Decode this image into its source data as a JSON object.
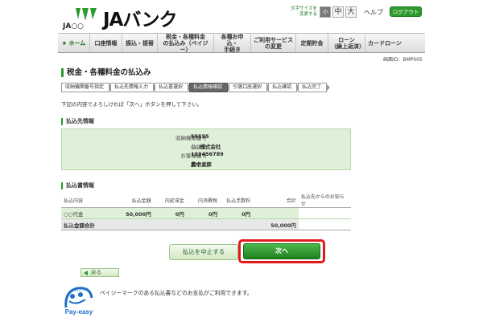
{
  "header": {
    "brand": "JAバンク",
    "ja_sub": "JA○○",
    "fontsize_label": "文字サイズを\n変更する",
    "fontsize_buttons": [
      "小",
      "中",
      "大"
    ],
    "help": "ヘルプ",
    "logout": "ログアウト"
  },
  "nav": {
    "items": [
      "★ ホーム",
      "口座情報",
      "振込・振替",
      "税金・各種料金\nの払込み（ペイジー）",
      "各種お申込・\n手続き",
      "ご利用サービス\nの変更",
      "定期貯金",
      "ローン\n（繰上返済）",
      "カードローン"
    ]
  },
  "screen_id": "画面ID：BMP005",
  "page_title": "税金・各種料金の払込み",
  "steps": [
    {
      "label": "収納機関番号指定",
      "active": false
    },
    {
      "label": "払込先情報入力",
      "active": false
    },
    {
      "label": "払込書選択",
      "active": false
    },
    {
      "label": "払込情報確認",
      "active": true
    },
    {
      "label": "引落口座選択",
      "active": false
    },
    {
      "label": "払込確認",
      "active": false
    },
    {
      "label": "払込完了",
      "active": false
    }
  ],
  "instruction": "下記の内容でよろしければ「次へ」ボタンを押して下さい。",
  "payee": {
    "section_title": "払込先情報",
    "rows": [
      {
        "label": "収納機関番号",
        "value": "55555"
      },
      {
        "label": "払込先",
        "value": "○○株式会社"
      },
      {
        "label": "お客様番号",
        "value": "123456789"
      },
      {
        "label": "お名前",
        "value": "農中太郎"
      }
    ]
  },
  "bill": {
    "section_title": "払込書情報",
    "headers": [
      "払込内容",
      "払込金額",
      "内延滞金",
      "内消費税",
      "払込手数料",
      "合計",
      "払込先からのお知らせ"
    ],
    "rows": [
      [
        "○○代金",
        "50,000円",
        "0円",
        "0円",
        "0円",
        "",
        ""
      ]
    ],
    "total_label": "払込金額合計",
    "total_value": "50,000円"
  },
  "buttons": {
    "cancel": "払込を中止する",
    "next": "次へ",
    "back": "戻る"
  },
  "payeasy": {
    "logo_top": "ペイジー",
    "logo_brand": "Pay-easy",
    "message": "ペイジーマークのある払込書などのお支払がご利用できます。"
  },
  "colors": {
    "accent_green": "#2c9a2c",
    "panel_green": "#dff0d8",
    "highlight_red": "#e01b1b"
  }
}
